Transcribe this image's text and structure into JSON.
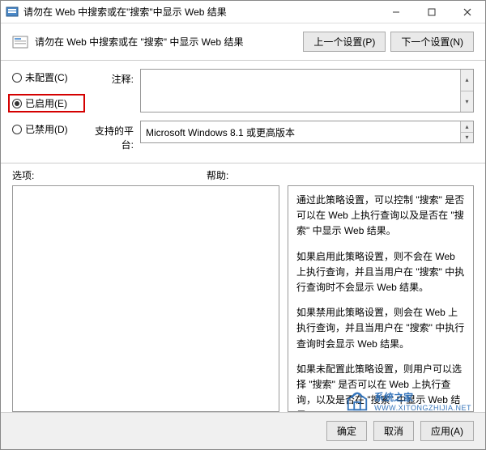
{
  "window": {
    "title": "请勿在 Web 中搜索或在\"搜索\"中显示 Web 结果"
  },
  "header": {
    "title": "请勿在 Web 中搜索或在 \"搜索\" 中显示 Web 结果",
    "prev_btn": "上一个设置(P)",
    "next_btn": "下一个设置(N)"
  },
  "radios": {
    "not_configured": "未配置(C)",
    "enabled": "已启用(E)",
    "disabled": "已禁用(D)"
  },
  "fields": {
    "note_label": "注释:",
    "note_value": "",
    "platform_label": "支持的平台:",
    "platform_value": "Microsoft Windows 8.1 或更高版本"
  },
  "lower": {
    "options_label": "选项:",
    "help_label": "帮助:"
  },
  "help": {
    "p1": "通过此策略设置，可以控制 \"搜索\" 是否可以在 Web 上执行查询以及是否在 \"搜索\" 中显示 Web 结果。",
    "p2": "如果启用此策略设置，则不会在 Web 上执行查询，并且当用户在 \"搜索\" 中执行查询时不会显示 Web 结果。",
    "p3": "如果禁用此策略设置，则会在 Web 上执行查询，并且当用户在 \"搜索\" 中执行查询时会显示 Web 结果。",
    "p4": "如果未配置此策略设置，则用户可以选择 \"搜索\" 是否可以在 Web 上执行查询，以及是否在 \"搜索\" 中显示 Web 结果。"
  },
  "footer": {
    "ok": "确定",
    "cancel": "取消",
    "apply": "应用(A)"
  },
  "watermark": {
    "title": "系统之家",
    "sub": "WWW.XITONGZHIJIA.NET"
  }
}
